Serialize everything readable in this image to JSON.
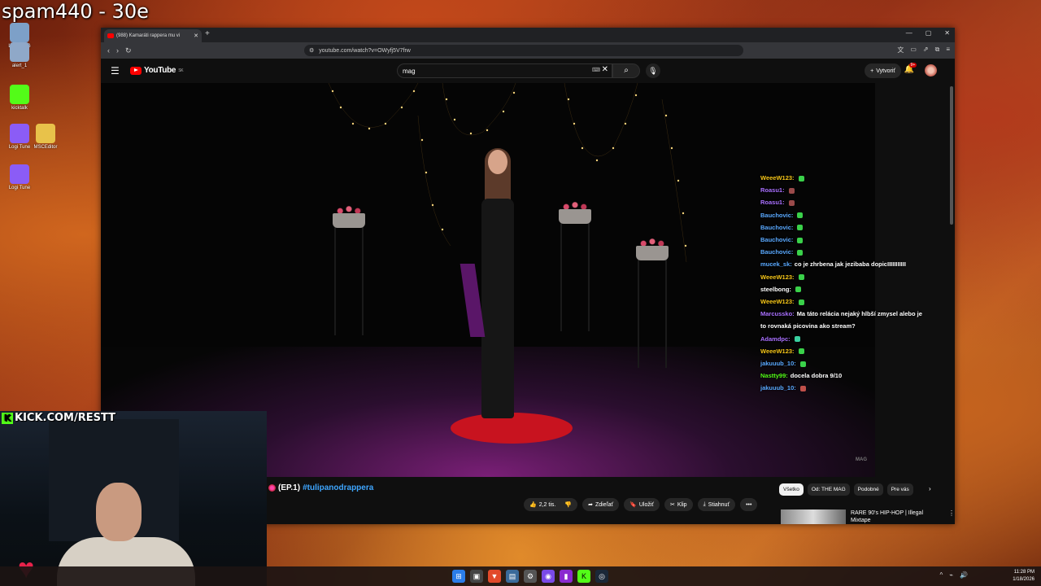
{
  "overlay": {
    "title": "spam440 - 30e",
    "kick": "KICK.COM/RESTT"
  },
  "desktop": {
    "icons": [
      {
        "label": "LogitechG HUB",
        "color": "#7da0c8"
      },
      {
        "label": "alert_1",
        "color": "#8fa8c8"
      },
      {
        "label": "kicktalk",
        "color": "#53fc18"
      },
      {
        "label": "Logi Tune",
        "color": "#8b5cf6"
      },
      {
        "label": "MSCEditor",
        "color": "#e8c24a"
      },
      {
        "label": "Logi Tune",
        "color": "#8b5cf6"
      }
    ]
  },
  "browser": {
    "tab_title": "(988) Kamaráti rappera mu vi",
    "url": "youtube.com/watch?v=OWyfj5V7frw"
  },
  "youtube": {
    "logo": "YouTube",
    "region": "SK",
    "search_value": "mag",
    "create_label": "Vytvoriť",
    "notif_badge": "9+",
    "video_title_prefix": "(EP.1)",
    "video_title_tag": "#tulipanodrappera",
    "watermark": "MAG",
    "actions": {
      "like_count": "2,2 tis.",
      "share": "Zdieľať",
      "save": "Uložiť",
      "clip": "Klip",
      "download": "Stiahnuť"
    },
    "chips": [
      "Všetko",
      "Od: THE MAG",
      "Podobné",
      "Pre vás"
    ],
    "recommendation": "RARE 90's HIP-HOP | Illegal Mixtape"
  },
  "chat": [
    {
      "user": "WeeeW123:",
      "color": "#f5c518",
      "msg": "",
      "emote": "#3ad14a"
    },
    {
      "user": "Roasu1:",
      "color": "#a970ff",
      "msg": "",
      "emote": "#9a4a4a"
    },
    {
      "user": "Roasu1:",
      "color": "#a970ff",
      "msg": "",
      "emote": "#9a4a4a"
    },
    {
      "user": "Bauchovic:",
      "color": "#5aa9ff",
      "msg": "",
      "emote": "#3ad14a"
    },
    {
      "user": "Bauchovic:",
      "color": "#5aa9ff",
      "msg": "",
      "emote": "#3ad14a"
    },
    {
      "user": "Bauchovic:",
      "color": "#5aa9ff",
      "msg": "",
      "emote": "#3ad14a"
    },
    {
      "user": "Bauchovic:",
      "color": "#5aa9ff",
      "msg": "",
      "emote": "#3ad14a"
    },
    {
      "user": "mucek_sk:",
      "color": "#5aa9ff",
      "msg": "co je zhrbena jak jezibaba dopicIIIIIIIIIII",
      "emote": ""
    },
    {
      "user": "WeeeW123:",
      "color": "#f5c518",
      "msg": "",
      "emote": "#3ad14a"
    },
    {
      "user": "steelbong:",
      "color": "#ffffff",
      "msg": "",
      "emote": "#3ad14a"
    },
    {
      "user": "WeeeW123:",
      "color": "#f5c518",
      "msg": "",
      "emote": "#3ad14a"
    },
    {
      "user": "Marcussko:",
      "color": "#a970ff",
      "msg": "Ma táto relácia nejaký hlbší zmysel alebo je to rovnaká picovina ako stream?",
      "emote": ""
    },
    {
      "user": "Adamdpc:",
      "color": "#a970ff",
      "msg": "",
      "emote": "#3ad1a0"
    },
    {
      "user": "WeeeW123:",
      "color": "#f5c518",
      "msg": "",
      "emote": "#3ad14a"
    },
    {
      "user": "jakuuub_10:",
      "color": "#5aa9ff",
      "msg": "",
      "emote": "#3ad14a"
    },
    {
      "user": "Nastty99:",
      "color": "#53fc18",
      "msg": "docela dobra 9/10",
      "emote": ""
    },
    {
      "user": "jakuuub_10:",
      "color": "#5aa9ff",
      "msg": "",
      "emote": "#c0504a"
    }
  ],
  "taskbar": {
    "time": "11:28 PM",
    "date": "1/18/2026"
  }
}
